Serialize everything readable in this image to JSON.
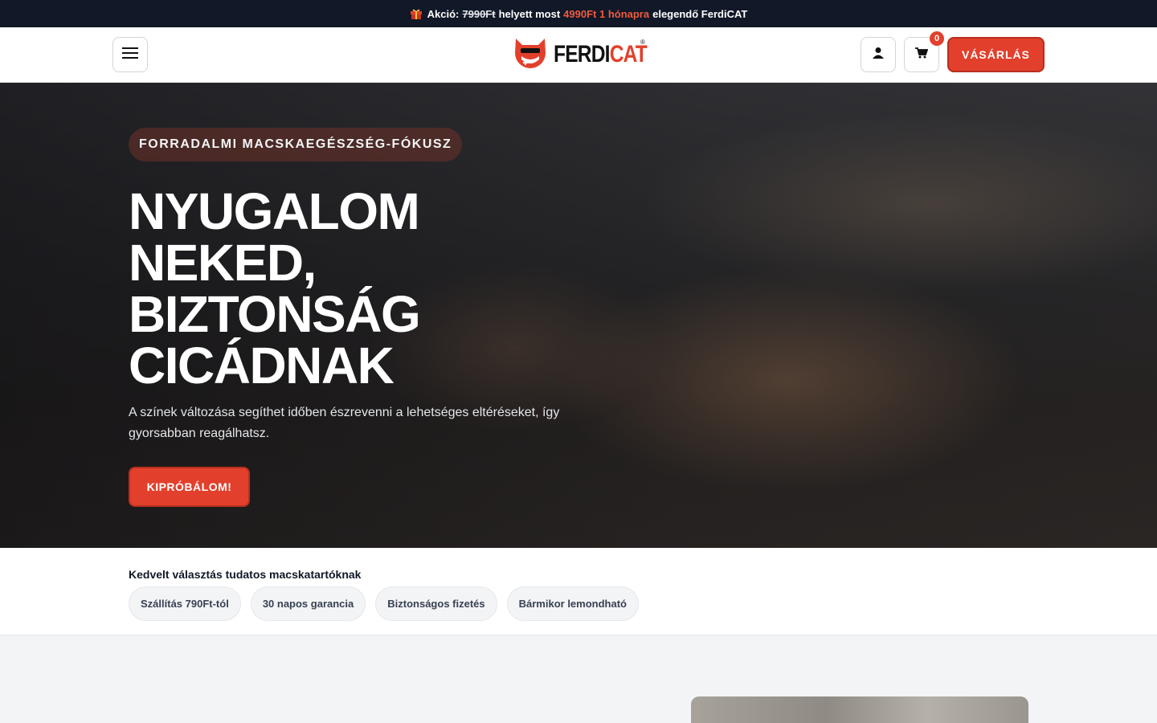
{
  "promo": {
    "icon": "gift-icon",
    "prefix": "Akció:",
    "old_price": "7990Ft",
    "middle": "helyett most",
    "new_price": "4990Ft 1 hónapra",
    "suffix": "elegendő FerdiCAT"
  },
  "header": {
    "logo_part1": "FERDI",
    "logo_part2": "CAT",
    "logo_reg": "®",
    "cart_count": "0",
    "buy_label": "VÁSÁRLÁS"
  },
  "hero": {
    "badge": "FORRADALMI MACSKAEGÉSZSÉG-FÓKUSZ",
    "title_lines": [
      "NYUGALOM",
      "NEKED,",
      "BIZTONSÁG",
      "CICÁDNAK"
    ],
    "description": "A színek változása segíthet időben észrevenni a lehetséges eltéréseket, így gyorsabban reagálhatsz.",
    "cta": "KIPRÓBÁLOM!"
  },
  "trust": {
    "title": "Kedvelt választás tudatos macskatartóknak",
    "chips": [
      "Szállítás 790Ft-tól",
      "30 napos garancia",
      "Biztonságos fizetés",
      "Bármikor lemondható"
    ]
  },
  "colors": {
    "accent": "#e2402c",
    "dark": "#111827"
  }
}
